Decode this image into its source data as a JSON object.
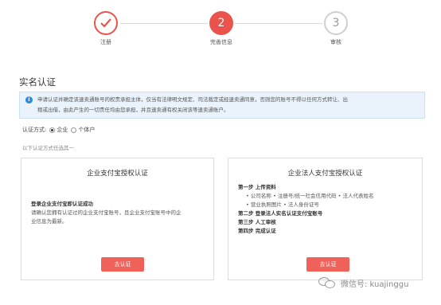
{
  "steps": [
    {
      "label": "注册",
      "number": "",
      "state": "done"
    },
    {
      "label": "完善信息",
      "number": "2",
      "state": "active"
    },
    {
      "label": "审核",
      "number": "3",
      "state": "todo"
    }
  ],
  "section_title": "实名认证",
  "notice": {
    "icon": "info-icon",
    "line1": "申请认证并确定该速卖通账号的权责承担主体，仅当有法律明文规定、司法裁定或经速卖通同意，否则您的账号不得以任何方式转让、出",
    "line2": "租或出借，由此产生的一切责任均由您承担，并且速卖通有权关闭该等速卖通账户。"
  },
  "auth_method": {
    "label": "认证方式:",
    "options": [
      {
        "label": "企业",
        "checked": true
      },
      {
        "label": "个体户",
        "checked": false
      }
    ]
  },
  "hint": "以下认证方式任选其一",
  "cards": {
    "left": {
      "title": "企业支付宝授权认证",
      "subtitle": "登录企业支付宝即认证成功",
      "desc1": "请确认您拥有认证过的企业支付宝账号，且企业支付宝账号中的企",
      "desc2": "业信息为最新。",
      "button": "去认证"
    },
    "right": {
      "title": "企业法人支付宝授权认证",
      "step1": "第一步 上传资料",
      "bullet1": "• 公司名称 • 注册号/统一社会信用代码 • 法人代表姓名",
      "bullet2": "• 营业执照图片 • 法人身份证号",
      "step2": "第二步 登录法人实名认证支付宝账号",
      "step3": "第三步 人工审核",
      "step4": "第四步 完成认证",
      "button": "去认证"
    }
  },
  "watermark": "微信号: kuajinggu",
  "colors": {
    "accent": "#e9534c",
    "button": "#f0615a",
    "notice_bg": "#eaf3fb",
    "info": "#2b8bd8"
  }
}
